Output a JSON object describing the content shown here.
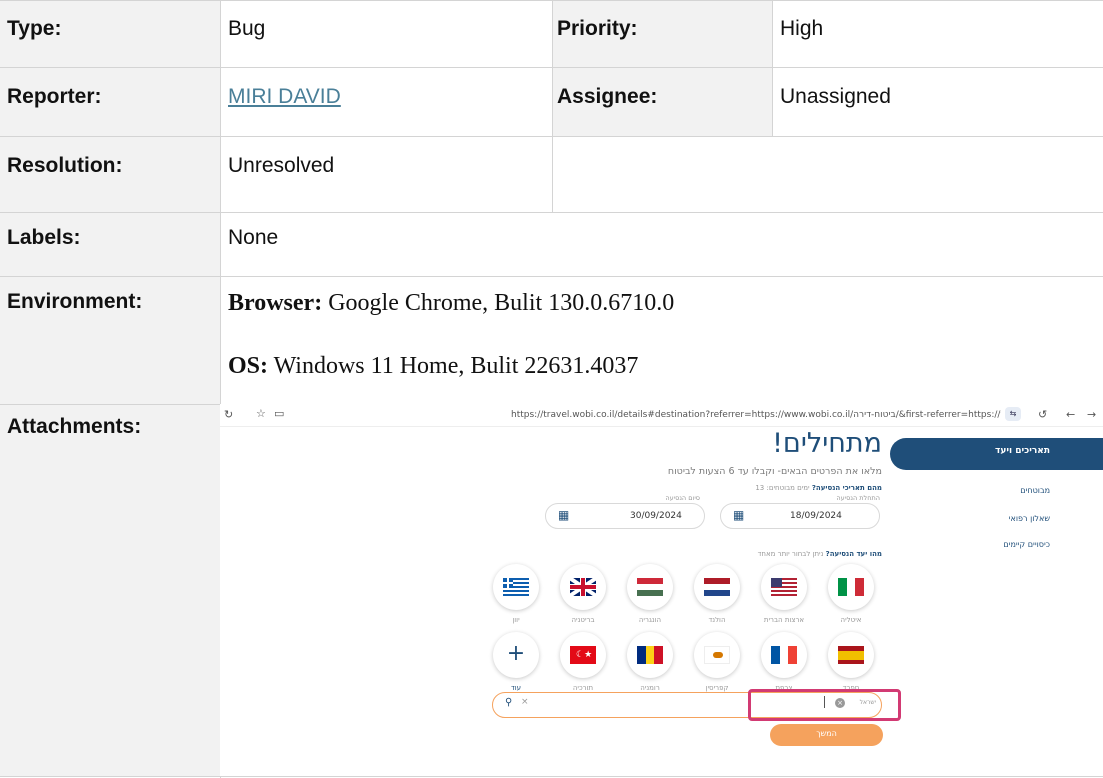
{
  "fields": {
    "type_label": "Type:",
    "type_value": "Bug",
    "priority_label": "Priority:",
    "priority_value": "High",
    "reporter_label": "Reporter:",
    "reporter_value": "MIRI DAVID",
    "assignee_label": "Assignee:",
    "assignee_value": "Unassigned",
    "resolution_label": "Resolution:",
    "resolution_value": "Unresolved",
    "labels_label": "Labels:",
    "labels_value": "None",
    "environment_label": "Environment:",
    "environment_browser_key": "Browser:",
    "environment_browser_value": " Google Chrome, Bulit 130.0.6710.0",
    "environment_os_key": "OS:",
    "environment_os_value": " Windows 11 Home, Bulit 22631.4037",
    "attachments_label": "Attachments:"
  },
  "colors": {
    "link": "#4a7f98",
    "label_bg": "#f2f2f2",
    "brand_navy": "#1f4e79",
    "accent_orange": "#f5a25d",
    "highlight_pink": "#d23a73"
  },
  "screenshot": {
    "url": "https://travel.wobi.co.il/details#destination?referrer=https://www.wobi.co.il/ביטוח-דירה/&first-referrer=https://www.wobi.co.il/",
    "icons": {
      "left": [
        "refresh-icon",
        "star-icon",
        "tab-icon"
      ],
      "right": [
        "site-settings-icon",
        "reload-icon",
        "back-icon",
        "forward-icon"
      ]
    },
    "title": "מתחילים!",
    "subtitle": "מלאו את הפרטים הבאים- וקבלו עד 6 הצעות לביטוח",
    "dates_question": "מהם תאריכי הנסיעה?",
    "dates_count": "ימים מבוטחים: 13",
    "departure_label": "התחלת הנסיעה",
    "departure_value": "18/09/2024",
    "return_label": "סיום הנסיעה",
    "return_value": "30/09/2024",
    "destination_question": "מהו יעד הנסיעה?",
    "destination_hint": "ניתן לבחור יותר מאחד",
    "countries_row1": [
      "איטליה",
      "ארצות הברית",
      "הולנד",
      "הונגריה",
      "בריטניה",
      "יוון"
    ],
    "countries_row2": [
      "ספרד",
      "צרפת",
      "קפריסין",
      "רומניה",
      "תורכיה"
    ],
    "more_label": "עוד",
    "search_chip": "ישראל",
    "continue_button": "המשך",
    "sidebar": {
      "active": "תאריכים ויעד",
      "items": [
        "מבוטחים",
        "שאלון רפואי",
        "כיסויים קיימים"
      ]
    }
  }
}
